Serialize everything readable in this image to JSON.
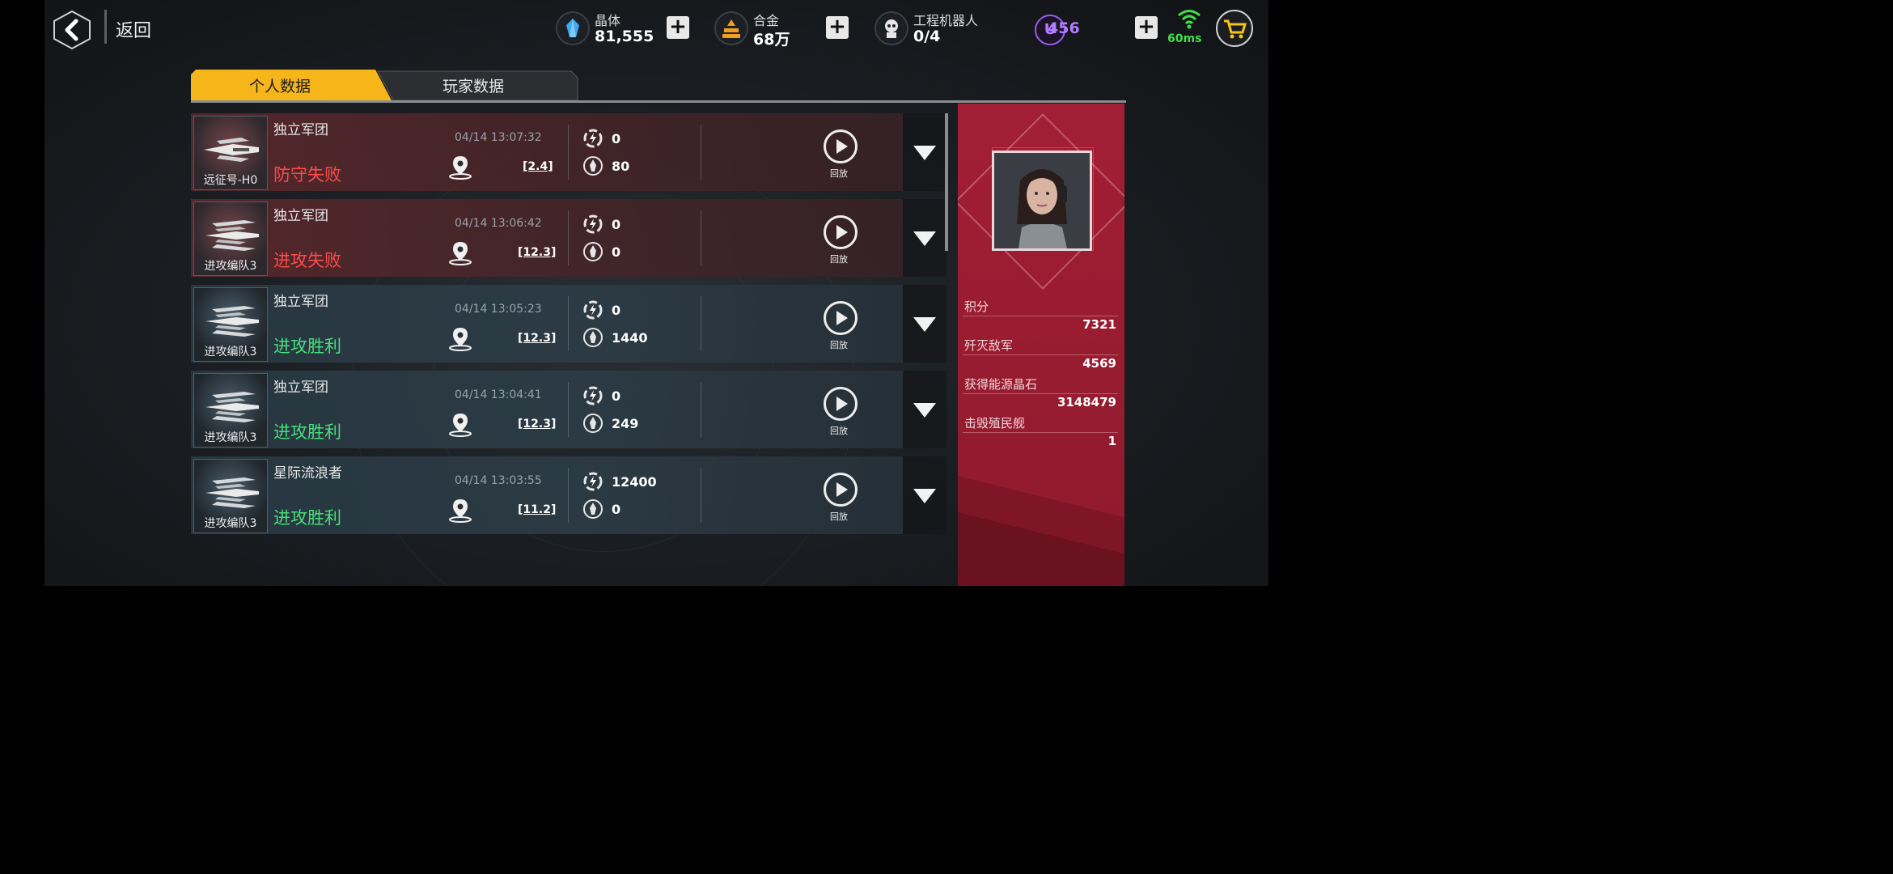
{
  "header": {
    "back_label": "返回",
    "resources": [
      {
        "name": "crystal",
        "label": "晶体",
        "value": "81,555",
        "icon": "crystal-icon"
      },
      {
        "name": "alloy",
        "label": "合金",
        "value": "68万",
        "icon": "alloy-icon"
      },
      {
        "name": "robot",
        "label": "工程机器人",
        "value": "0/4",
        "icon": "robot-icon"
      }
    ],
    "premium_value": "456",
    "premium_symbol": "U",
    "ping": "60ms",
    "colors": {
      "premium": "#9b5cf0",
      "ping": "#3fe04a",
      "alloy": "#f0a020",
      "crystal": "#3fa8f0"
    }
  },
  "tabs": [
    "个人数据",
    "玩家数据"
  ],
  "battles": [
    {
      "unit": "远征号-H0",
      "faction": "独立军团",
      "result": "防守失败",
      "result_type": "loss",
      "time": "04/14 13:07:32",
      "coord": "[2.4]",
      "energy": "0",
      "score": "80",
      "replay": "回放"
    },
    {
      "unit": "进攻编队3",
      "faction": "独立军团",
      "result": "进攻失败",
      "result_type": "loss",
      "time": "04/14 13:06:42",
      "coord": "[12.3]",
      "energy": "0",
      "score": "0",
      "replay": "回放"
    },
    {
      "unit": "进攻编队3",
      "faction": "独立军团",
      "result": "进攻胜利",
      "result_type": "win",
      "time": "04/14 13:05:23",
      "coord": "[12.3]",
      "energy": "0",
      "score": "1440",
      "replay": "回放"
    },
    {
      "unit": "进攻编队3",
      "faction": "独立军团",
      "result": "进攻胜利",
      "result_type": "win",
      "time": "04/14 13:04:41",
      "coord": "[12.3]",
      "energy": "0",
      "score": "249",
      "replay": "回放"
    },
    {
      "unit": "进攻编队3",
      "faction": "星际流浪者",
      "result": "进攻胜利",
      "result_type": "win",
      "time": "04/14 13:03:55",
      "coord": "[11.2]",
      "energy": "12400",
      "score": "0",
      "replay": "回放"
    }
  ],
  "profile": {
    "stats": [
      {
        "label": "积分",
        "value": "7321"
      },
      {
        "label": "歼灭敌军",
        "value": "4569"
      },
      {
        "label": "获得能源晶石",
        "value": "3148479"
      },
      {
        "label": "击毁殖民舰",
        "value": "1"
      }
    ]
  }
}
